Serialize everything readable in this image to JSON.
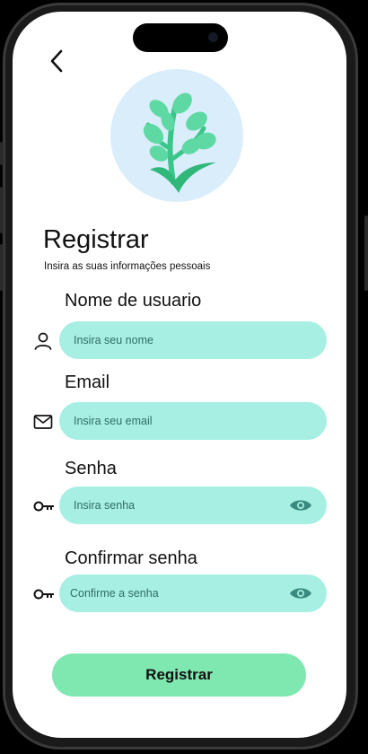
{
  "header": {
    "back_icon": "chevron-left-icon"
  },
  "logo": {
    "icon": "plant-leaf-icon",
    "colors": {
      "circle": "#daedfb",
      "leaf": "#5fd9a4",
      "leaf_dark": "#2fb87a"
    }
  },
  "title": "Registrar",
  "subtitle": "Insira as suas informações pessoais",
  "fields": [
    {
      "label": "Nome de usuario",
      "placeholder": "Insira seu nome",
      "value": "",
      "icon": "user-icon"
    },
    {
      "label": "Email",
      "placeholder": "Insira seu email",
      "value": "",
      "icon": "mail-icon"
    },
    {
      "label": "Senha",
      "placeholder": "Insira senha",
      "value": "",
      "icon": "key-icon",
      "toggle_icon": "eye-icon"
    },
    {
      "label": "Confirmar senha",
      "placeholder": "Confirme a senha",
      "value": "",
      "icon": "key-icon",
      "toggle_icon": "eye-icon"
    }
  ],
  "submit_label": "Registrar",
  "colors": {
    "input_bg": "#a7efe3",
    "button_bg": "#7ee8b0",
    "placeholder": "#2f6d66",
    "eye": "#3a8a7f"
  }
}
